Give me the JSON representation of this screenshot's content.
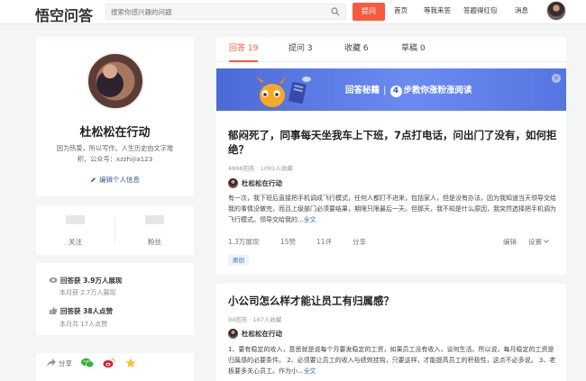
{
  "header": {
    "logo": "悟空问答",
    "search_placeholder": "搜索你感兴趣的问题",
    "ask_button": "提问",
    "nav": [
      "首页",
      "等我来答",
      "答题得红包",
      "消息"
    ]
  },
  "profile": {
    "name": "杜松松在行动",
    "bio": "因为热爱，所以写作。人生历史由文字堆积，公众号：xzzhijia123",
    "edit_label": "编辑个人信息"
  },
  "stats": {
    "followers_label": "关注",
    "fans_label": "粉丝"
  },
  "honors": {
    "views_main": "回答获 3.9万人展现",
    "views_sub": "本月获 2.7万人展现",
    "likes_main": "回答获 38人点赞",
    "likes_sub": "本月共 17人点赞"
  },
  "share": {
    "label": "分享"
  },
  "tabs": [
    {
      "label": "回答 19",
      "active": true
    },
    {
      "label": "提问 3",
      "active": false
    },
    {
      "label": "收藏 6",
      "active": false
    },
    {
      "label": "草稿 0",
      "active": false
    }
  ],
  "banner": {
    "brand": "回答秘籍",
    "step_num": "4",
    "text": "步教你涨粉涨阅读"
  },
  "posts": [
    {
      "title": "郁闷死了，同事每天坐我车上下班，7点打电话，问出门了没有，如何拒绝？",
      "meta": "4866回答 · 1091人收藏",
      "author": "杜松松在行动",
      "body": "有一次，我下班后直接把手机调成飞行模式，任何人都打不进来，包括家人，但是没有办法，因为我知道当天领导交给我的事情没做完，而且上级部门必须要结果，期限只限最后一天。但那天，我不知是什么原因，我突然选择把手机调为飞行模式。领导交给我的...",
      "more": "全文",
      "actions": {
        "views": "1.3万展现",
        "likes": "15赞",
        "comments": "11评",
        "share": "分享",
        "edit": "编辑",
        "settings": "设置"
      },
      "tag": "原创"
    },
    {
      "title": "小公司怎么样才能让员工有归属感？",
      "meta": "94回答 · 167人收藏",
      "author": "杜松松在行动",
      "body": "1、要有稳定的收入，意思就是说每个月要发稳定的工资，如果员工没有收入，谈何生活。所以说，每月稳定的工资是归属感的必要条件。 2、必须要让员工的收入与绩效挂钩，只要这样，才能提高员工的积极性，这点不必多说。 3、老板要多关心员工。作为小...",
      "more": "全文"
    }
  ],
  "colors": {
    "accent": "#f85a3e",
    "link": "#3b6ea8",
    "banner": "#5a7ae6"
  }
}
